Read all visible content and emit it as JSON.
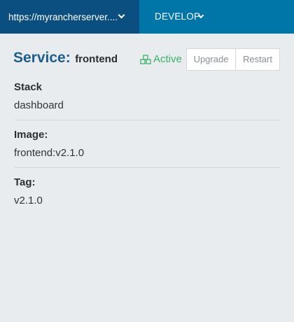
{
  "header": {
    "environment_url": "https://myrancherserver....",
    "stack_menu_label": "DEVELOP"
  },
  "service": {
    "title_prefix": "Service:",
    "name": "frontend",
    "status": "Active",
    "status_color": "#3bb16a",
    "status_icon": "server-stack-icon"
  },
  "actions": {
    "upgrade_label": "Upgrade",
    "restart_label": "Restart"
  },
  "fields": [
    {
      "label": "Stack",
      "value": "dashboard"
    },
    {
      "label": "Image:",
      "value": "frontend:v2.1.0"
    },
    {
      "label": "Tag:",
      "value": "v2.1.0"
    }
  ],
  "colors": {
    "header_bg": "#0075a8",
    "env_select_bg": "#0a4f7f",
    "page_bg": "#e8ecef",
    "title_color": "#1d5f8a"
  }
}
